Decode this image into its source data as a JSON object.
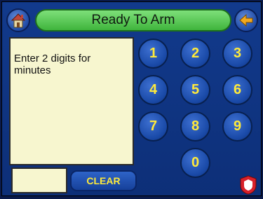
{
  "header": {
    "title": "Ready To Arm"
  },
  "message": "Enter 2 digits for\nminutes",
  "entry_value": "",
  "clear_label": "CLEAR",
  "keypad": [
    "1",
    "2",
    "3",
    "4",
    "5",
    "6",
    "7",
    "8",
    "9",
    "0"
  ],
  "icons": {
    "home": "home-icon",
    "back": "back-arrow-icon",
    "alarm": "shield-alarm-icon"
  },
  "colors": {
    "background": "#123a8c",
    "title_bar": "#5cc858",
    "key_text": "#ffea3a",
    "panel": "#f7f6cf"
  }
}
